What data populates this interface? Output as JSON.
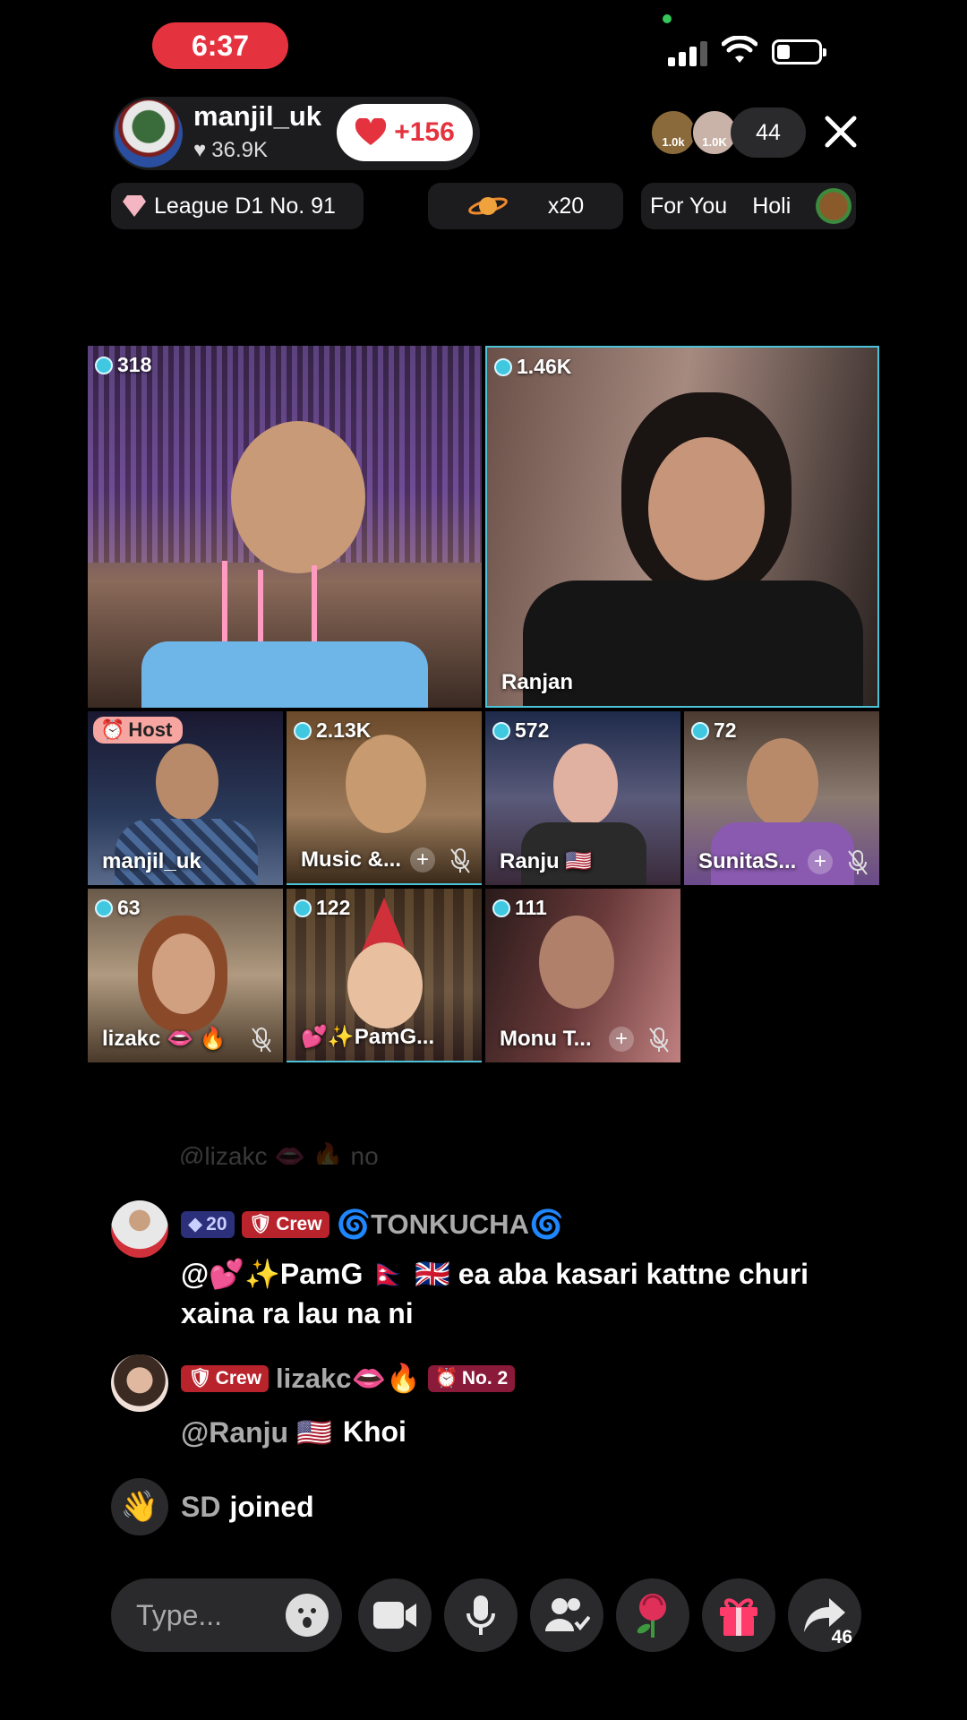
{
  "status": {
    "time": "6:37"
  },
  "host": {
    "name": "manjil_uk",
    "likes": "36.9K",
    "like_gain": "+156"
  },
  "viewers": {
    "avatar_1_label": "1.0k",
    "avatar_2_label": "1.0K",
    "count": "44"
  },
  "chips": {
    "league": "League D1 No. 91",
    "multiplier": "x20",
    "ticker_1": "For You",
    "ticker_2": "Holi"
  },
  "grid": {
    "tiles": [
      {
        "score": "318",
        "name": ""
      },
      {
        "score": "1.46K",
        "name": "Ranjan"
      },
      {
        "score": "",
        "name": "manjil_uk",
        "tag": "Host"
      },
      {
        "score": "2.13K",
        "name": "Music &..."
      },
      {
        "score": "572",
        "name": "Ranju 🇺🇸"
      },
      {
        "score": "72",
        "name": "SunitaS..."
      },
      {
        "score": "63",
        "name": "lizakc 👄 🔥"
      },
      {
        "score": "122",
        "name": "💕✨PamG..."
      },
      {
        "score": "111",
        "name": "Monu T..."
      }
    ]
  },
  "chat": {
    "faded": "@lizakc 👄 🔥 no",
    "messages": [
      {
        "level": "20",
        "badge": "Crew",
        "user": "🌀TONKUCHA🌀",
        "text": "@💕✨PamG 🇳🇵 🇬🇧 ea aba kasari kattne churi xaina ra lau na ni"
      },
      {
        "badge": "Crew",
        "user": "lizakc👄🔥",
        "rank": "No. 2",
        "mention": "@Ranju 🇺🇸",
        "text": "Khoi"
      }
    ],
    "join_user": "SD",
    "join_text": "joined"
  },
  "bottom": {
    "placeholder": "Type...",
    "share_count": "46"
  },
  "colors": {
    "live_red": "#e5323f",
    "gem": "#40c8e0",
    "crew": "#b8232c",
    "host_tag": "#f7a5a1"
  },
  "icons": [
    "heart-icon",
    "gem-icon",
    "planet-icon",
    "close-icon",
    "emoji-icon",
    "video-camera-icon",
    "microphone-icon",
    "guests-icon",
    "rose-icon",
    "gift-icon",
    "share-icon",
    "wave-icon",
    "mic-muted-icon"
  ]
}
